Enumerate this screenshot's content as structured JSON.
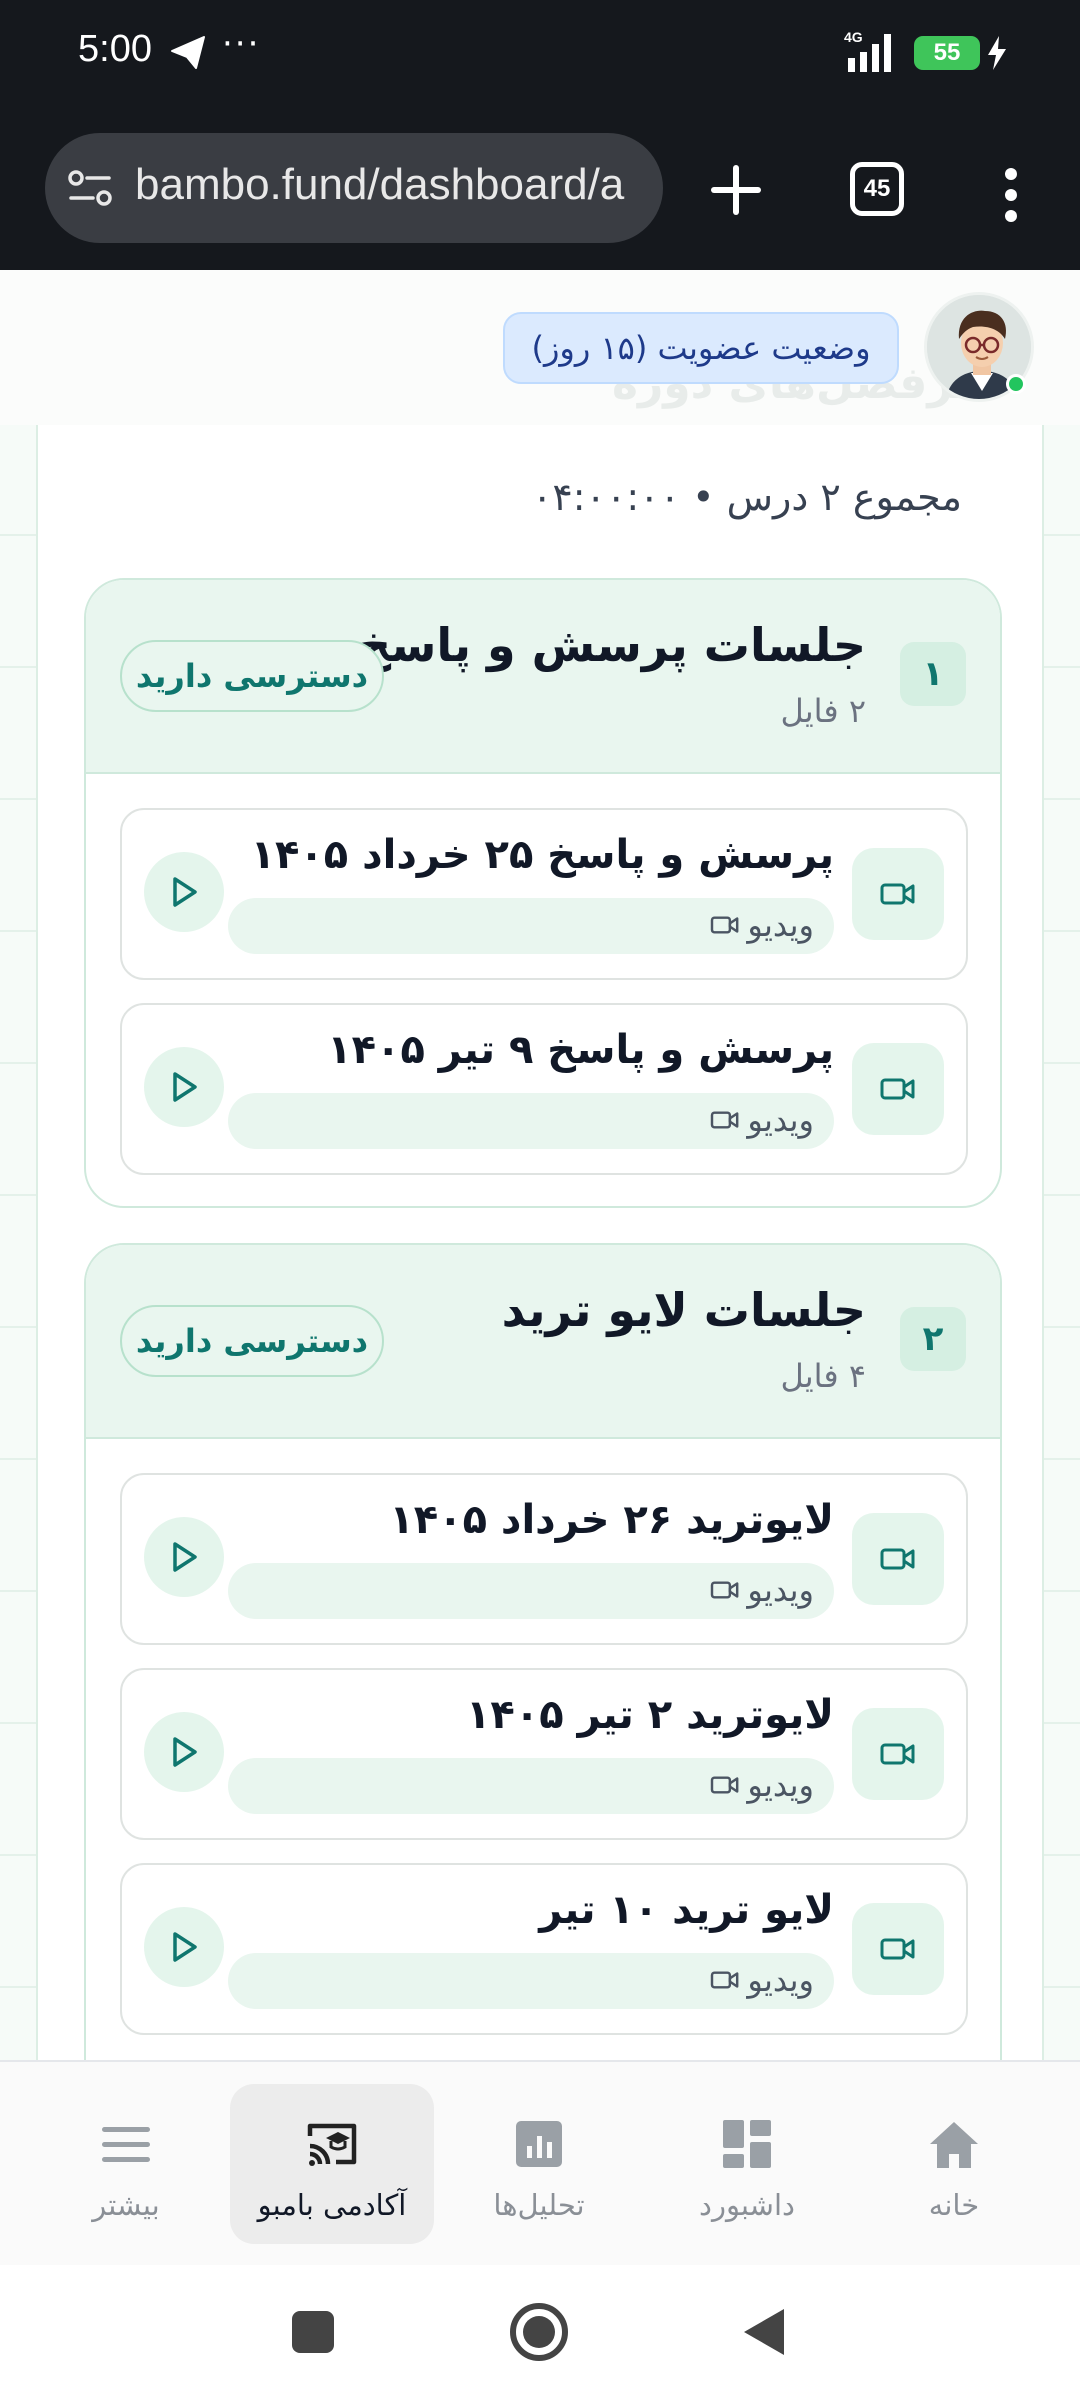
{
  "status_bar": {
    "time": "5:00",
    "dots": "···",
    "battery": "55",
    "network": "4G"
  },
  "browser": {
    "url": "bambo.fund/dashboard/a",
    "tab_count": "45"
  },
  "header": {
    "ghost_title": "سرفصل‌های دوره",
    "membership_badge": "وضعیت عضویت (۱۵ روز)"
  },
  "summary": "مجموع ۲ درس • ۰۴:۰۰:۰۰",
  "sections": [
    {
      "number": "۱",
      "title": "جلسات پرسش و پاسخ",
      "file_count": "۲ فایل",
      "access": "دسترسی دارید",
      "items": [
        {
          "title": "پرسش و پاسخ ۲۵ خرداد ۱۴۰۵",
          "type": "ویدیو"
        },
        {
          "title": "پرسش و پاسخ ۹ تیر ۱۴۰۵",
          "type": "ویدیو"
        }
      ]
    },
    {
      "number": "۲",
      "title": "جلسات لایو ترید",
      "file_count": "۴ فایل",
      "access": "دسترسی دارید",
      "items": [
        {
          "title": "لایوترید ۲۶ خرداد ۱۴۰۵",
          "type": "ویدیو"
        },
        {
          "title": "لایوترید ۲ تیر ۱۴۰۵",
          "type": "ویدیو"
        },
        {
          "title": "لایو ترید ۱۰ تیر",
          "type": "ویدیو"
        }
      ]
    }
  ],
  "bottom_nav": [
    {
      "label": "خانه",
      "icon": "home-icon"
    },
    {
      "label": "داشبورد",
      "icon": "dashboard-icon"
    },
    {
      "label": "تحلیل‌ها",
      "icon": "chart-icon"
    },
    {
      "label": "آکادمی بامبو",
      "icon": "academy-icon",
      "active": true
    },
    {
      "label": "بیشتر",
      "icon": "menu-icon"
    }
  ],
  "colors": {
    "accent": "#0f766e",
    "section_bg": "#e9f6ef",
    "badge_blue": "#dbeafe"
  }
}
